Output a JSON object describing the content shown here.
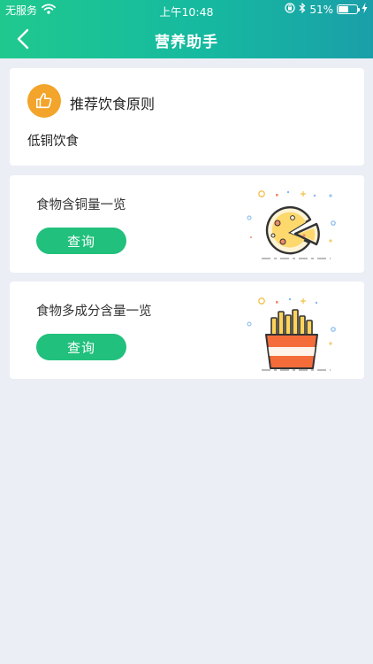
{
  "status_bar": {
    "carrier": "无服务",
    "time": "上午10:48",
    "battery": "51%",
    "battery_level": 0.51
  },
  "navbar": {
    "title": "营养助手",
    "back_icon": "chevron-left-icon"
  },
  "principle_card": {
    "icon": "thumbs-up-icon",
    "title": "推荐饮食原则",
    "text": "低铜饮食"
  },
  "food_cards": [
    {
      "label": "食物含铜量一览",
      "button": "查询",
      "illustration": "pizza-illustration"
    },
    {
      "label": "食物多成分含量一览",
      "button": "查询",
      "illustration": "fries-illustration"
    }
  ],
  "colors": {
    "header_start": "#1fc98e",
    "header_end": "#1a9fa9",
    "button": "#21c07c",
    "thumb_bg": "#f3a42b",
    "background": "#eceef6"
  }
}
